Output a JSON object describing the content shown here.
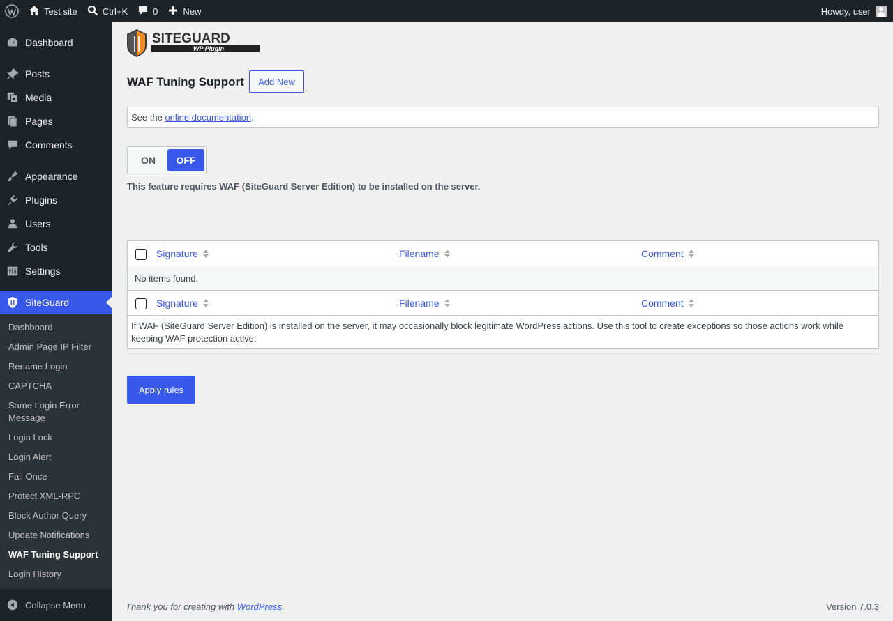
{
  "adminbar": {
    "site_name": "Test site",
    "search_shortcut": "Ctrl+K",
    "comments_count": "0",
    "new_label": "New",
    "greeting": "Howdy, user"
  },
  "sidebar": {
    "items": [
      {
        "label": "Dashboard",
        "icon": "dashboard-icon"
      },
      {
        "label": "Posts",
        "icon": "pin-icon"
      },
      {
        "label": "Media",
        "icon": "media-icon"
      },
      {
        "label": "Pages",
        "icon": "pages-icon"
      },
      {
        "label": "Comments",
        "icon": "comment-icon"
      },
      {
        "label": "Appearance",
        "icon": "brush-icon"
      },
      {
        "label": "Plugins",
        "icon": "plugin-icon"
      },
      {
        "label": "Users",
        "icon": "user-icon"
      },
      {
        "label": "Tools",
        "icon": "wrench-icon"
      },
      {
        "label": "Settings",
        "icon": "settings-icon"
      },
      {
        "label": "SiteGuard",
        "icon": "siteguard-icon"
      }
    ],
    "submenu": [
      "Dashboard",
      "Admin Page IP Filter",
      "Rename Login",
      "CAPTCHA",
      "Same Login Error Message",
      "Login Lock",
      "Login Alert",
      "Fail Once",
      "Protect XML-RPC",
      "Block Author Query",
      "Update Notifications",
      "WAF Tuning Support",
      "Login History"
    ],
    "collapse_label": "Collapse Menu"
  },
  "main": {
    "logo_text": "SITEGUARD",
    "logo_sub": "WP Plugin",
    "title": "WAF Tuning Support",
    "add_new": "Add New",
    "notice_prefix": "See the ",
    "notice_link": "online documentation",
    "notice_suffix": ".",
    "toggle_on": "ON",
    "toggle_off": "OFF",
    "toggle_state": "OFF",
    "requirement": "This feature requires WAF (SiteGuard Server Edition) to be installed on the server.",
    "table": {
      "columns": [
        "Signature",
        "Filename",
        "Comment"
      ],
      "empty": "No items found."
    },
    "description": "If WAF (SiteGuard Server Edition) is installed on the server, it may occasionally block legitimate WordPress actions. Use this tool to create exceptions so those actions work while keeping WAF protection active.",
    "apply_label": "Apply rules"
  },
  "footer": {
    "thanks_prefix": "Thank you for creating with ",
    "thanks_link": "WordPress",
    "thanks_suffix": ".",
    "version": "Version 7.0.3"
  },
  "colors": {
    "accent": "#3858e9",
    "adminbar_bg": "#1d2327",
    "submenu_bg": "#2c3338"
  }
}
